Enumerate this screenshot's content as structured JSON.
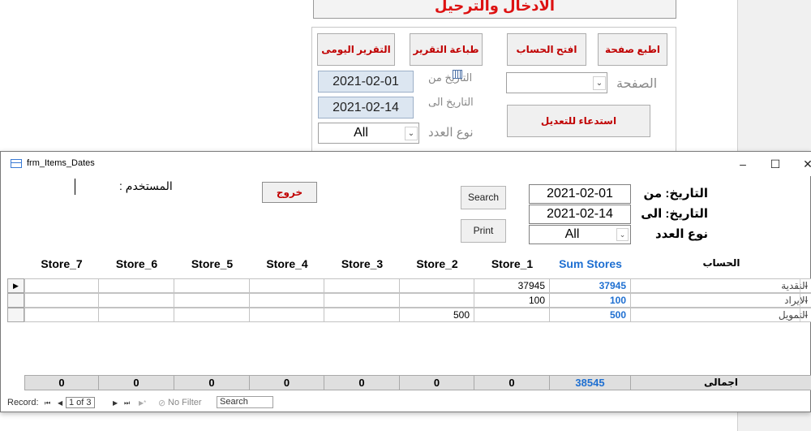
{
  "background_form": {
    "title": "الادخال والترحيل",
    "buttons": {
      "print_page": "اطبع صفحة",
      "open_account": "افتح الحساب",
      "print_report": "طباعة التقرير",
      "daily_report": "التقرير اليومى",
      "recall_edit": "استدعاء للتعديل"
    },
    "page_label": "الصفحة",
    "date_from_label": "التاريخ من",
    "date_to_label": "التاريخ الى",
    "count_type_label": "نوع العدد",
    "date_from": "2021-02-01",
    "date_to": "2021-02-14",
    "count_type": "All"
  },
  "window": {
    "title": "frm_Items_Dates",
    "controls": {
      "minimize": "–",
      "maximize": "☐",
      "close": "✕"
    },
    "user_label": "المستخدم :",
    "exit_label": "خروج",
    "search_label": "Search",
    "print_label": "Print",
    "date_from": "2021-02-01",
    "date_to": "2021-02-14",
    "count_type": "All",
    "date_from_label": "التاريخ: من",
    "date_to_label": "التاريخ: الى",
    "count_type_label": "نوع العدد"
  },
  "grid": {
    "headers": {
      "account": "الحساب",
      "sum": "Sum Stores",
      "store_1": "Store_1",
      "store_2": "Store_2",
      "store_3": "Store_3",
      "store_4": "Store_4",
      "store_5": "Store_5",
      "store_6": "Store_6",
      "store_7": "Store_7"
    },
    "rows": [
      {
        "account": "النقدية",
        "sum": "37945",
        "store_1": "37945",
        "store_2": ""
      },
      {
        "account": "الايراد",
        "sum": "100",
        "store_1": "100",
        "store_2": ""
      },
      {
        "account": "التمويل",
        "sum": "500",
        "store_1": "",
        "store_2": "500"
      }
    ],
    "totals": {
      "label": "اجمالى",
      "sum": "38545",
      "store_1": "0",
      "store_2": "0",
      "store_3": "0",
      "store_4": "0",
      "store_5": "0",
      "store_6": "0",
      "store_7": "0"
    }
  },
  "nav": {
    "record_label": "Record:",
    "first": "⏮",
    "prev": "◀",
    "current": "1 of 3",
    "next": "▶",
    "last": "⏭",
    "new": "▶*",
    "filter": "No Filter",
    "search": "Search"
  }
}
